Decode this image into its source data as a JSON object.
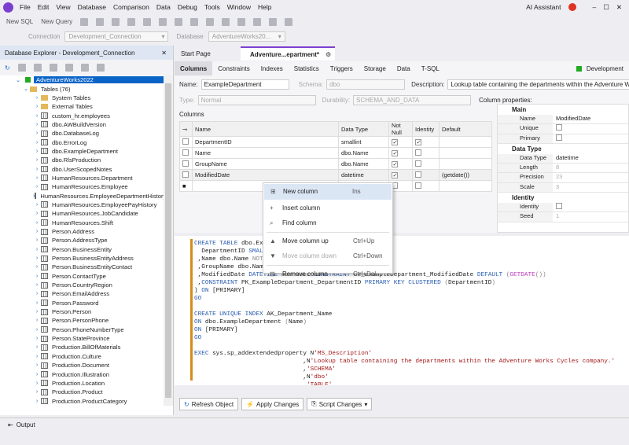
{
  "menu": [
    "File",
    "Edit",
    "View",
    "Database",
    "Comparison",
    "Data",
    "Debug",
    "Tools",
    "Window",
    "Help"
  ],
  "ai_assistant": "AI Assistant",
  "toolbar": {
    "new_sql": "New SQL",
    "new_query": "New Query"
  },
  "connbar": {
    "connection_label": "Connection",
    "connection_value": "Development_Connection",
    "database_label": "Database",
    "database_value": "AdventureWorks20..."
  },
  "explorer": {
    "title": "Database Explorer - Development_Connection",
    "root": "AdventureWorks2022",
    "tables": "Tables (76)",
    "items": [
      "System Tables",
      "External Tables",
      "custom_hr.employees",
      "dbo.AWBuildVersion",
      "dbo.DatabaseLog",
      "dbo.ErrorLog",
      "dbo.ExampleDepartment",
      "dbo.RlsProduction",
      "dbo.UserScopedNotes",
      "HumanResources.Department",
      "HumanResources.Employee",
      "HumanResources.EmployeeDepartmentHistory",
      "HumanResources.EmployeePayHistory",
      "HumanResources.JobCandidate",
      "HumanResources.Shift",
      "Person.Address",
      "Person.AddressType",
      "Person.BusinessEntity",
      "Person.BusinessEntityAddress",
      "Person.BusinessEntityContact",
      "Person.ContactType",
      "Person.CountryRegion",
      "Person.EmailAddress",
      "Person.Password",
      "Person.Person",
      "Person.PersonPhone",
      "Person.PhoneNumberType",
      "Person.StateProvince",
      "Production.BillOfMaterials",
      "Production.Culture",
      "Production.Document",
      "Production.Illustration",
      "Production.Location",
      "Production.Product",
      "Production.ProductCategory"
    ]
  },
  "tabs": {
    "start": "Start Page",
    "doc": "Adventure...epartment*"
  },
  "subtabs": [
    "Columns",
    "Constraints",
    "Indexes",
    "Statistics",
    "Triggers",
    "Storage",
    "Data",
    "T-SQL"
  ],
  "env": "Development",
  "form": {
    "name_label": "Name:",
    "name": "ExampleDepartment",
    "schema_label": "Schema:",
    "schema": "dbo",
    "desc_label": "Description:",
    "desc": "Lookup table containing the departments within the Adventure Work",
    "type_label": "Type:",
    "type": "Normal",
    "dur_label": "Durability:",
    "dur": "SCHEMA_AND_DATA",
    "columns_label": "Columns",
    "colprops_label": "Column properties:"
  },
  "grid": {
    "headers": [
      "Name",
      "Data Type",
      "Not Null",
      "Identity",
      "Default"
    ],
    "rows": [
      {
        "name": "DepartmentID",
        "type": "smallint",
        "nn": "✓",
        "id": "✓",
        "def": ""
      },
      {
        "name": "Name",
        "type": "dbo.Name",
        "nn": "✓",
        "id": "",
        "def": ""
      },
      {
        "name": "GroupName",
        "type": "dbo.Name",
        "nn": "✓",
        "id": "",
        "def": ""
      },
      {
        "name": "ModifiedDate",
        "type": "datetime",
        "nn": "✓",
        "id": "",
        "def": "(getdate())"
      }
    ]
  },
  "props": {
    "main": "Main",
    "name_k": "Name",
    "name_v": "ModifiedDate",
    "unique": "Unique",
    "primary": "Primary",
    "dt": "Data Type",
    "dt_k": "Data Type",
    "dt_v": "datetime",
    "len_k": "Length",
    "len_v": "8",
    "prec_k": "Precision",
    "prec_v": "23",
    "scale_k": "Scale",
    "scale_v": "3",
    "identity": "Identity",
    "id_k": "Identity",
    "seed_k": "Seed",
    "seed_v": "1"
  },
  "context_menu": [
    {
      "label": "New column",
      "key": "Ins"
    },
    {
      "label": "Insert column",
      "key": ""
    },
    {
      "label": "Find column",
      "key": ""
    },
    {
      "label": "Move column up",
      "key": "Ctrl+Up"
    },
    {
      "label": "Move column down",
      "key": "Ctrl+Down"
    },
    {
      "label": "Remove column",
      "key": "Ctrl+Del"
    }
  ],
  "buttons": {
    "refresh": "Refresh Object",
    "apply": "Apply Changes",
    "script": "Script Changes"
  },
  "output": "Output"
}
